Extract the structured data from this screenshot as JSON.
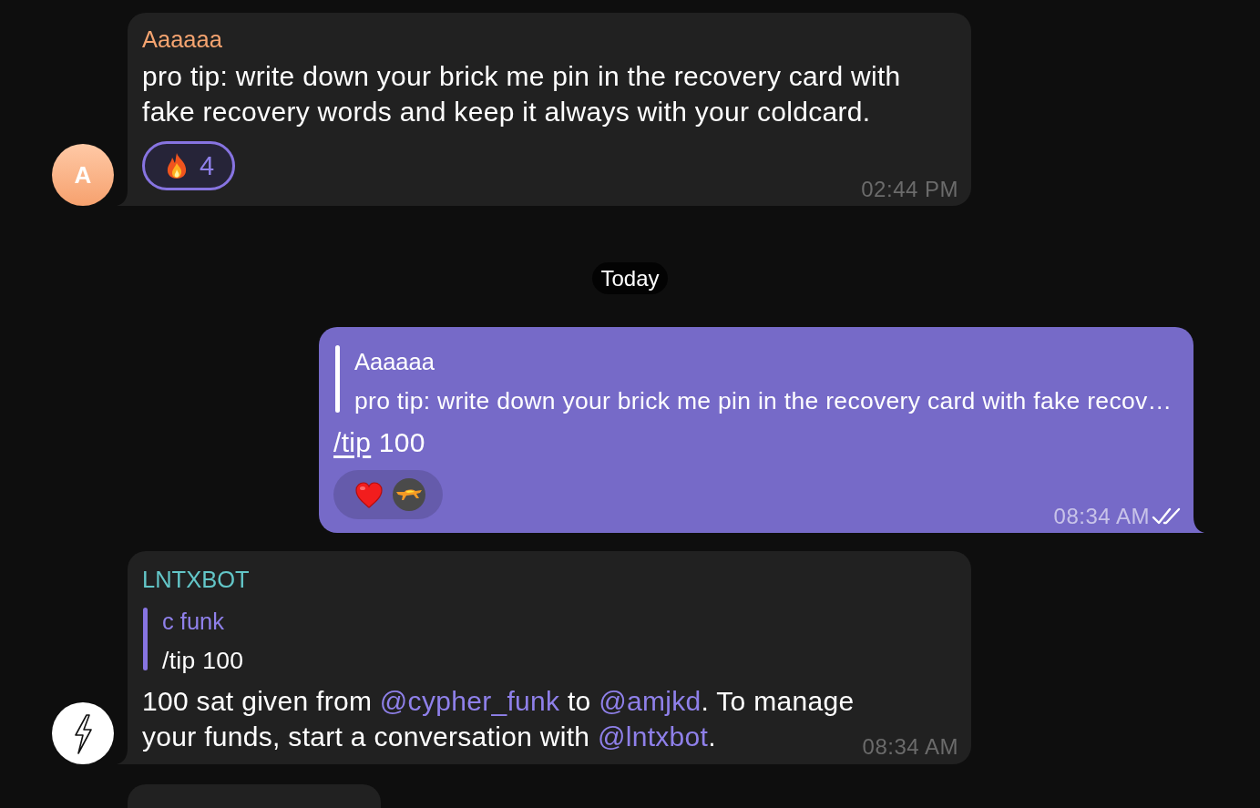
{
  "messages": [
    {
      "kind": "incoming",
      "sender": "Aaaaaa",
      "color": "#f5a470",
      "avatar": {
        "kind": "letter",
        "letter": "A"
      },
      "body": [
        {
          "kind": "plain",
          "text": "pro tip: write down your brick me pin in the recovery card with fake recovery words and keep it always with your coldcard."
        }
      ],
      "reactions": [
        {
          "kind": "fire",
          "count": "4",
          "selected": true
        }
      ],
      "time": "02:44 PM"
    },
    {
      "kind": "date",
      "label": "Today"
    },
    {
      "kind": "outgoing",
      "reply": {
        "sender": "Aaaaaa",
        "text": "pro tip: write down your brick me pin in the recovery card with fake recov…"
      },
      "body": [
        {
          "kind": "command",
          "text": "/tip"
        },
        {
          "kind": "plain",
          "text": " 100"
        }
      ],
      "reactions": [
        {
          "kind": "heart",
          "selected": false,
          "reactor_avatar": true
        }
      ],
      "time": "08:34 AM",
      "read": true
    },
    {
      "kind": "incoming",
      "sender": "LNTXBOT",
      "color": "#63c6c8",
      "avatar": {
        "kind": "bolt"
      },
      "reply": {
        "sender": "c funk",
        "text": "/tip 100"
      },
      "body": [
        {
          "kind": "plain",
          "text": "100 sat given from "
        },
        {
          "kind": "mention",
          "text": "@cypher_funk"
        },
        {
          "kind": "plain",
          "text": " to "
        },
        {
          "kind": "mention",
          "text": "@amjkd"
        },
        {
          "kind": "plain",
          "text": ". To manage your funds, start a conversation with "
        },
        {
          "kind": "mention",
          "text": "@lntxbot"
        },
        {
          "kind": "plain",
          "text": "."
        }
      ],
      "time": "08:34 AM"
    },
    {
      "kind": "partial"
    }
  ]
}
